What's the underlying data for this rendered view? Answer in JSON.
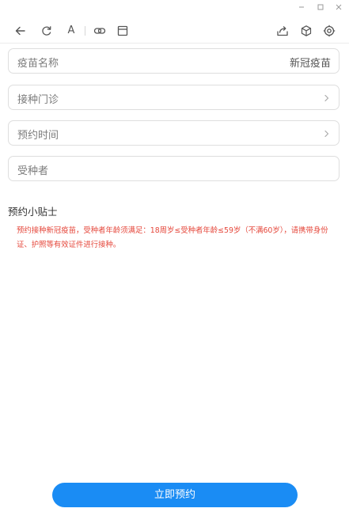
{
  "window": {
    "controls": [
      "minimize-icon",
      "maximize-icon",
      "close-icon"
    ]
  },
  "toolbar": {
    "icons": [
      "back-arrow-icon",
      "refresh-icon",
      "font-icon",
      "link-icon",
      "window-icon",
      "share-icon",
      "cube-icon",
      "settings-icon"
    ],
    "font_glyph": "A"
  },
  "form": {
    "vaccine": {
      "label": "疫苗名称",
      "value": "新冠疫苗"
    },
    "clinic": {
      "label": "接种门诊"
    },
    "time": {
      "label": "预约时间"
    },
    "recipient": {
      "label": "受种者"
    }
  },
  "tips": {
    "title": "预约小贴士",
    "body": "预约接种新冠疫苗，受种者年龄须满足：18周岁≤受种者年龄≤59岁（不满60岁），请携带身份证、护照等有效证件进行接种。"
  },
  "submit_label": "立即预约",
  "colors": {
    "accent": "#1a8cf4",
    "tips_text": "#e5473b"
  }
}
